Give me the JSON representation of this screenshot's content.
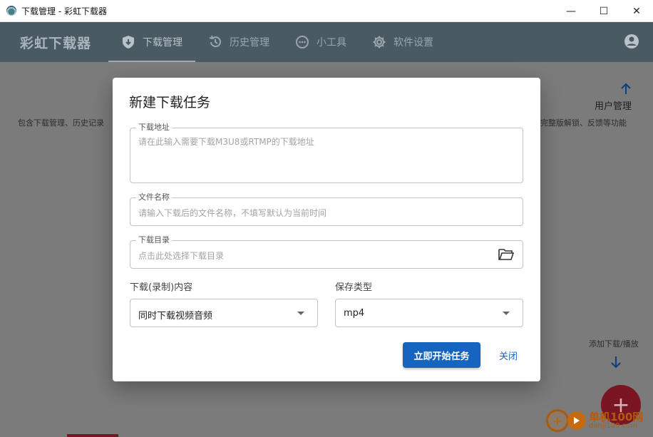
{
  "window": {
    "title": "下载管理 - 彩虹下载器",
    "minimize": "—",
    "maximize": "☐",
    "close": "✕"
  },
  "appbar": {
    "brand": "彩虹下载器",
    "tabs": [
      {
        "label": "下载管理",
        "icon": "download-shield-icon",
        "active": true
      },
      {
        "label": "历史管理",
        "icon": "history-icon",
        "active": false
      },
      {
        "label": "小工具",
        "icon": "tools-icon",
        "active": false
      },
      {
        "label": "软件设置",
        "icon": "gear-icon",
        "active": false
      }
    ],
    "account_icon": "account-circle-icon"
  },
  "background": {
    "left_text": "包含下载管理、历史记录",
    "right_text": "完整版解锁、反馈等功能",
    "user_management": "用户管理",
    "add_hint": "添加下载/播放",
    "fab_label": "+",
    "watermark_cn": "单机100网",
    "watermark_url": "danji100.com"
  },
  "dialog": {
    "title": "新建下载任务",
    "url_field": {
      "label": "下载地址",
      "placeholder": "请在此输入需要下载M3U8或RTMP的下载地址"
    },
    "filename_field": {
      "label": "文件名称",
      "placeholder": "请输入下载后的文件名称，不填写默认为当前时间"
    },
    "dir_field": {
      "label": "下载目录",
      "placeholder": "点击此处选择下载目录"
    },
    "content_select": {
      "label": "下载(录制)内容",
      "value": "同时下载视频音频"
    },
    "type_select": {
      "label": "保存类型",
      "value": "mp4"
    },
    "start_button": "立即开始任务",
    "close_button": "关闭"
  },
  "colors": {
    "appbar": "#4a5a63",
    "primary": "#1565c0",
    "fab": "#7a1621"
  }
}
